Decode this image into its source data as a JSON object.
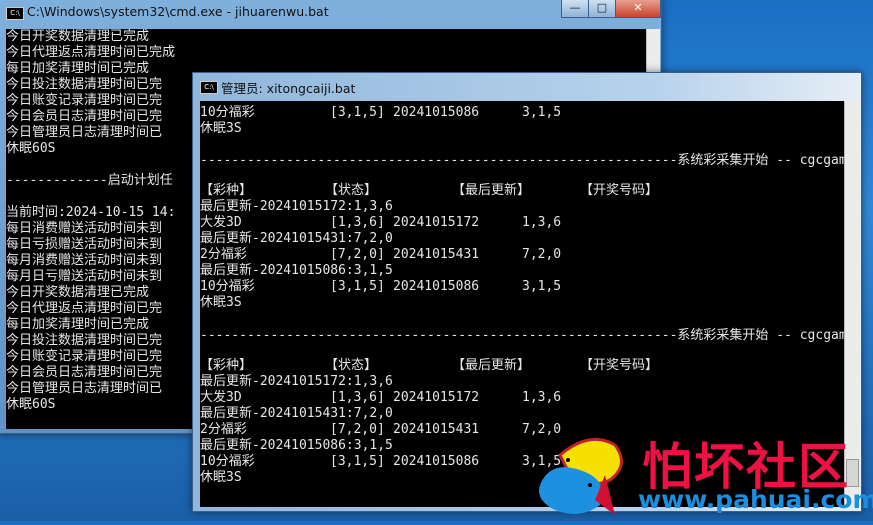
{
  "window1": {
    "title": "C:\\Windows\\system32\\cmd.exe - jihuarenwu.bat",
    "icon": "C:\\",
    "controls": {
      "minimize": "—",
      "maximize": "□",
      "close": "✕"
    },
    "lines": [
      "今日开奖数据清理已完成",
      "今日代理返点清理时间已完成",
      "每日加奖清理时间已完成",
      "今日投注数据清理时间已完",
      "今日账变记录清理时间已完",
      "今日会员日志清理时间已完",
      "今日管理员日志清理时间已",
      "休眠60S",
      "",
      "-------------启动计划任",
      "",
      "当前时间:2024-10-15 14:",
      "每日消费赠送活动时间未到",
      "每日亏损赠送活动时间未到",
      "每月消费赠送活动时间未到",
      "每月日亏赠送活动时间未到",
      "今日开奖数据清理已完成",
      "今日代理返点清理时间已完",
      "每日加奖清理时间已完成",
      "今日投注数据清理时间已完",
      "今日账变记录清理时间已完",
      "今日会员日志清理时间已完",
      "今日管理员日志清理时间已",
      "休眠60S"
    ]
  },
  "window2": {
    "title": "管理员:  xitongcaiji.bat",
    "icon": "C:\\",
    "top_lines": [
      {
        "name": "10分福彩",
        "state": "[3,1,5]",
        "issue": "20241015086",
        "numbers": "3,1,5"
      }
    ],
    "sleep": "休眠3S",
    "separator": "-------------------------------------------------------------系统彩采集开始 -- cgcgame-------------------------------------",
    "headers": [
      "【彩种】",
      "【状态】",
      "【最后更新】",
      "【开奖号码】"
    ],
    "blocks": [
      {
        "rows": [
          {
            "update": "最后更新-20241015172:1,3,6",
            "name": "大发3D",
            "state": "[1,3,6]",
            "issue": "20241015172",
            "numbers": "1,3,6"
          },
          {
            "update": "最后更新-20241015431:7,2,0",
            "name": "2分福彩",
            "state": "[7,2,0]",
            "issue": "20241015431",
            "numbers": "7,2,0"
          },
          {
            "update": "最后更新-20241015086:3,1,5",
            "name": "10分福彩",
            "state": "[3,1,5]",
            "issue": "20241015086",
            "numbers": "3,1,5"
          }
        ]
      },
      {
        "rows": [
          {
            "update": "最后更新-20241015172:1,3,6",
            "name": "大发3D",
            "state": "[1,3,6]",
            "issue": "20241015172",
            "numbers": "1,3,6"
          },
          {
            "update": "最后更新-20241015431:7,2,0",
            "name": "2分福彩",
            "state": "[7,2,0]",
            "issue": "20241015431",
            "numbers": "7,2,0"
          },
          {
            "update": "最后更新-20241015086:3,1,5",
            "name": "10分福彩",
            "state": "[3,1,5]",
            "issue": "20241015086",
            "numbers": "3,1,5"
          }
        ]
      }
    ]
  },
  "watermark": {
    "text": "怕坏社区",
    "url": "www.pahuai.com"
  }
}
